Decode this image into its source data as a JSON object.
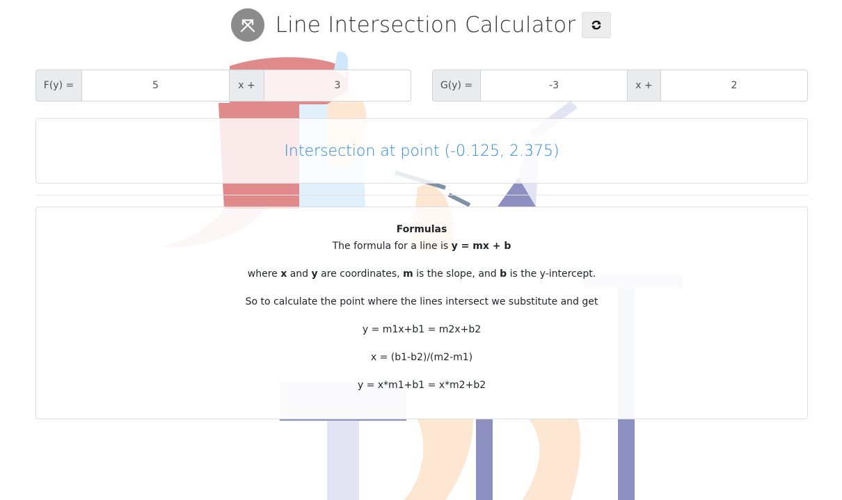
{
  "header": {
    "title": "Line Intersection Calculator",
    "logo_icon": "intersecting-arrows-icon",
    "refresh_icon": "refresh-icon"
  },
  "f_line": {
    "label": "F(y) =",
    "slope": "5",
    "x_label": "x +",
    "intercept": "3"
  },
  "g_line": {
    "label": "G(y) =",
    "slope": "-3",
    "x_label": "x +",
    "intercept": "2"
  },
  "result": {
    "text": "Intersection at point (-0.125, 2.375)"
  },
  "formulas": {
    "title": "Formulas",
    "line1_prefix": "The formula for a line is ",
    "line1_bold": "y = mx + b",
    "line2_where": "where ",
    "line2_x": "x",
    "line2_and": " and ",
    "line2_y": "y",
    "line2_coords": " are coordinates, ",
    "line2_m": "m",
    "line2_slope": " is the slope, and ",
    "line2_b": "b",
    "line2_intercept": " is the y-intercept.",
    "line3": "So to calculate the point where the lines intersect we substitute and get",
    "line4": "y = m1x+b1 = m2x+b2",
    "line5": "x = (b1-b2)/(m2-m1)",
    "line6": "y = x*m1+b1 = x*m2+b2"
  },
  "colors": {
    "accent": "#2b87e4",
    "addon_bg": "#e9ecef",
    "logo_bg": "#8c8c8c"
  }
}
